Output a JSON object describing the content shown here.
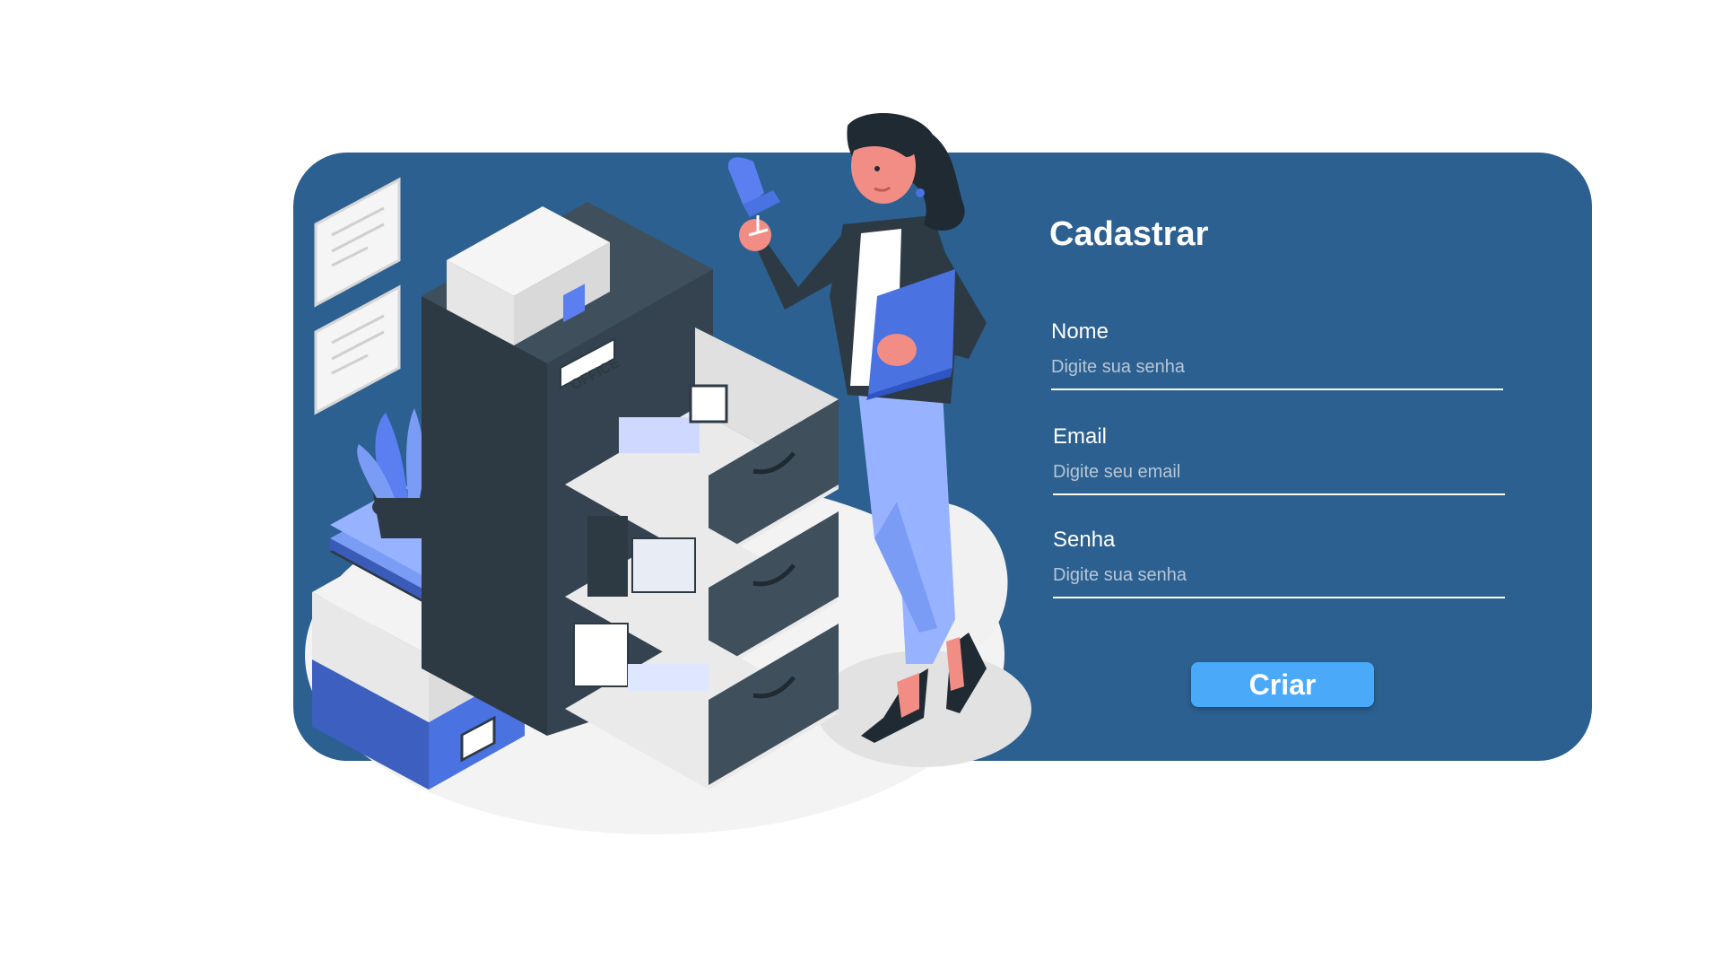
{
  "form": {
    "title": "Cadastrar",
    "fields": [
      {
        "label": "Nome",
        "placeholder": "Digite sua senha",
        "value": ""
      },
      {
        "label": "Email",
        "placeholder": "Digite seu email",
        "value": ""
      },
      {
        "label": "Senha",
        "placeholder": "Digite sua senha",
        "value": ""
      }
    ],
    "submit_label": "Criar"
  },
  "illustration": {
    "sign_text": "OFFICE"
  },
  "colors": {
    "card_background": "#2c6090",
    "button": "#4aa9f9",
    "accent_blue": "#5b7ff0",
    "dark_cabinet": "#2d3a44"
  }
}
